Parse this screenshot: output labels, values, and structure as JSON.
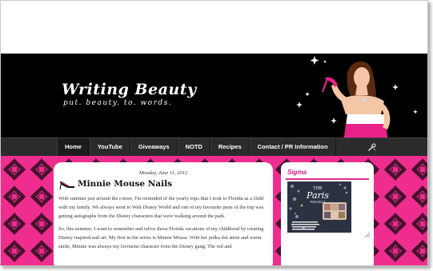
{
  "header": {
    "blog_title": "Writing Beauty",
    "blog_description": "put. beauty. to. words."
  },
  "nav": {
    "items": [
      {
        "label": "Home",
        "active": true
      },
      {
        "label": "YouTube",
        "active": false
      },
      {
        "label": "Giveaways",
        "active": false
      },
      {
        "label": "NOTD",
        "active": false
      },
      {
        "label": "Recipes",
        "active": false
      },
      {
        "label": "Contact / PR Information",
        "active": false
      }
    ],
    "tools_icon": "wrench-screwdriver-icon"
  },
  "post": {
    "date": "Monday, June 11, 2012",
    "title": "Minnie Mouse Nails",
    "title_icon": "high-heel-shoe-icon",
    "paragraphs": [
      "With summer just around the corner, I'm reminded of the yearly trips that I took to Florida as a child with my family. We always went to Walt Disney World and one of my favourite parts of the trip was getting autographs from the Disney characters that were walking around the park.",
      "So, this summer, I want to remember and relive those Florida vacations of my childhood by creating Disney inspired nail art. My first in the series is Minnie Mouse. With her polka dot attire and warm smile, Minnie was always my favourite character from the Disney gang. The red and"
    ]
  },
  "sidebar": {
    "widget_title": "Sigma",
    "ad_image": {
      "heading": "THE Paris PROJECT",
      "caption": "RECEIVE A COMPLIMENTARY GIFT WHEN YOU SPEND $50 OR MORE AT SIGMABEAUTY.COM"
    }
  },
  "colors": {
    "pink": "#ee2d8f",
    "magenta_accent": "#d11a7d",
    "header_bg": "#000000",
    "nav_bg": "#2b2b2b"
  }
}
